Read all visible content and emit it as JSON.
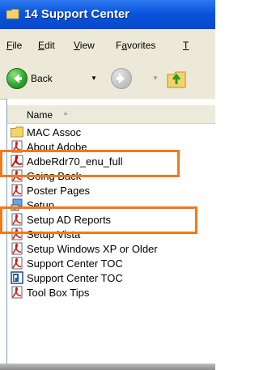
{
  "window": {
    "title": "14 Support Center"
  },
  "menu": [
    {
      "label": "File",
      "underline": "F",
      "rest": "ile"
    },
    {
      "label": "Edit",
      "underline": "E",
      "rest": "dit"
    },
    {
      "label": "View",
      "underline": "V",
      "rest": "iew"
    },
    {
      "label": "Favorites",
      "pre": "F",
      "underline": "a",
      "rest": "vorites"
    },
    {
      "label": "T",
      "underline": "T",
      "rest": ""
    }
  ],
  "toolbar": {
    "back_label": "Back"
  },
  "list": {
    "header": "Name",
    "items": [
      {
        "label": "MAC Assoc",
        "icon": "folder-icon"
      },
      {
        "label": "About Adobe",
        "icon": "pdf-icon"
      },
      {
        "label": "AdbeRdr70_enu_full",
        "icon": "adobe-installer-icon"
      },
      {
        "label": "Going Back",
        "icon": "pdf-icon"
      },
      {
        "label": "Poster Pages",
        "icon": "pdf-icon"
      },
      {
        "label": "Setup",
        "icon": "setup-icon"
      },
      {
        "label": "Setup AD Reports",
        "icon": "pdf-icon"
      },
      {
        "label": "Setup Vista",
        "icon": "pdf-icon"
      },
      {
        "label": "Setup Windows XP or Older",
        "icon": "pdf-icon"
      },
      {
        "label": "Support Center TOC",
        "icon": "pdf-icon"
      },
      {
        "label": "Support Center TOC",
        "icon": "publisher-icon"
      },
      {
        "label": "Tool Box Tips",
        "icon": "pdf-icon"
      }
    ]
  },
  "colors": {
    "titlebar": "#0a55dd",
    "highlight": "#f07a1a",
    "chrome": "#ece9d8"
  }
}
